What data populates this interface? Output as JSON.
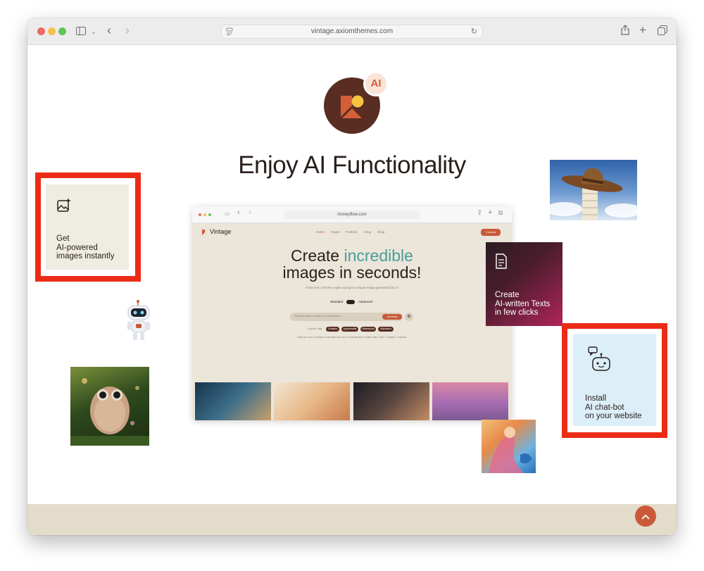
{
  "browser": {
    "url": "vintage.axiomthemes.com",
    "colors": {
      "close": "#ed6a5e",
      "minimize": "#f5bf4f",
      "maximize": "#61c554"
    }
  },
  "hero": {
    "badge": "AI",
    "title": "Enjoy AI Functionality"
  },
  "cards": {
    "images": {
      "label": "Get\nAI-powered\nimages instantly",
      "icon": "image-sparkle-icon"
    },
    "texts": {
      "label": "Create\nAI-written Texts\nin few clicks",
      "icon": "document-icon"
    },
    "chatbot": {
      "label": "Install\nAI chat-bot\non your website",
      "icon": "robot-chat-icon"
    }
  },
  "mockup": {
    "url": "moneyflow.com",
    "brand": "Vintage",
    "nav": [
      "Home",
      "Pages",
      "Portfolio",
      "Blog",
      "Shop"
    ],
    "nav_button": "Contact",
    "headline_part1": "Create ",
    "headline_accent": "incredible",
    "headline_part2": "images in seconds!",
    "subtitle": "Enter text, choose a style and get a unique image generated by AI",
    "toggle_left": "Standard",
    "toggle_right": "Advanced",
    "prompt_placeholder": "Describe what you want or hit a tag below",
    "generate_button": "Generate",
    "tags_label": "Popular Tags:",
    "tags": [
      "Creative",
      "Hyperreality",
      "Steampunk",
      "Animation"
    ],
    "limits_note": "Limits per hour: 10 images for all visitors and up to 3 requests from a single visitor. Used: 0 images, 0 requests."
  },
  "accent_colors": {
    "red_outline": "#ec2b16",
    "brand": "#5a2d22",
    "accent_orange": "#c85a3a",
    "teal": "#4a9e9a"
  },
  "controls": {
    "scroll_top_icon": "chevron-up-icon"
  }
}
